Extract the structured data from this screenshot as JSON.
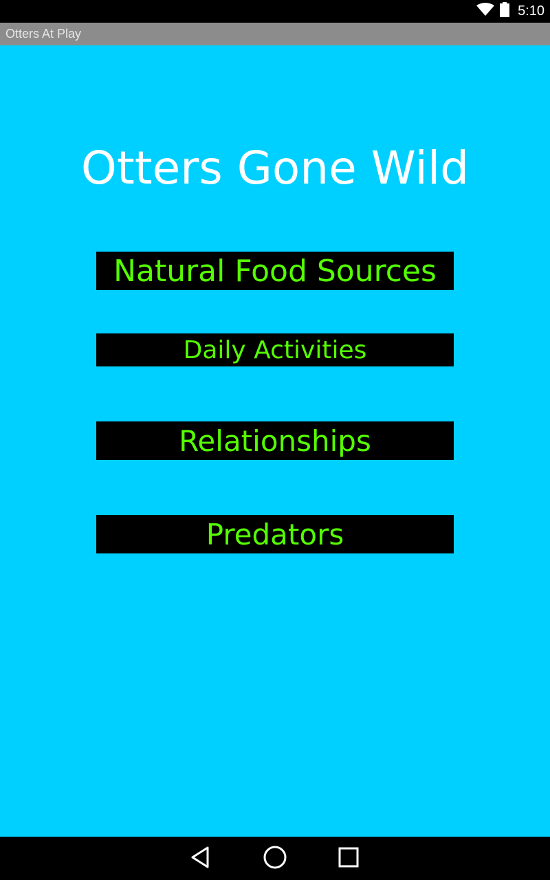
{
  "status_bar": {
    "time": "5:10",
    "icons": [
      "wifi-icon",
      "battery-icon"
    ]
  },
  "title_bar": {
    "title": "Otters At Play"
  },
  "main": {
    "heading": "Otters Gone Wild",
    "buttons": [
      {
        "label": "Natural Food Sources"
      },
      {
        "label": "Daily Activities"
      },
      {
        "label": "Relationships"
      },
      {
        "label": "Predators"
      }
    ]
  },
  "nav_bar": {
    "icons": [
      "back-icon",
      "home-icon",
      "recents-icon"
    ]
  },
  "colors": {
    "background": "#00D0FF",
    "button_bg": "#000000",
    "button_text": "#55FF00",
    "heading": "#FFFFFF",
    "title_bar": "#8C8C8C"
  }
}
